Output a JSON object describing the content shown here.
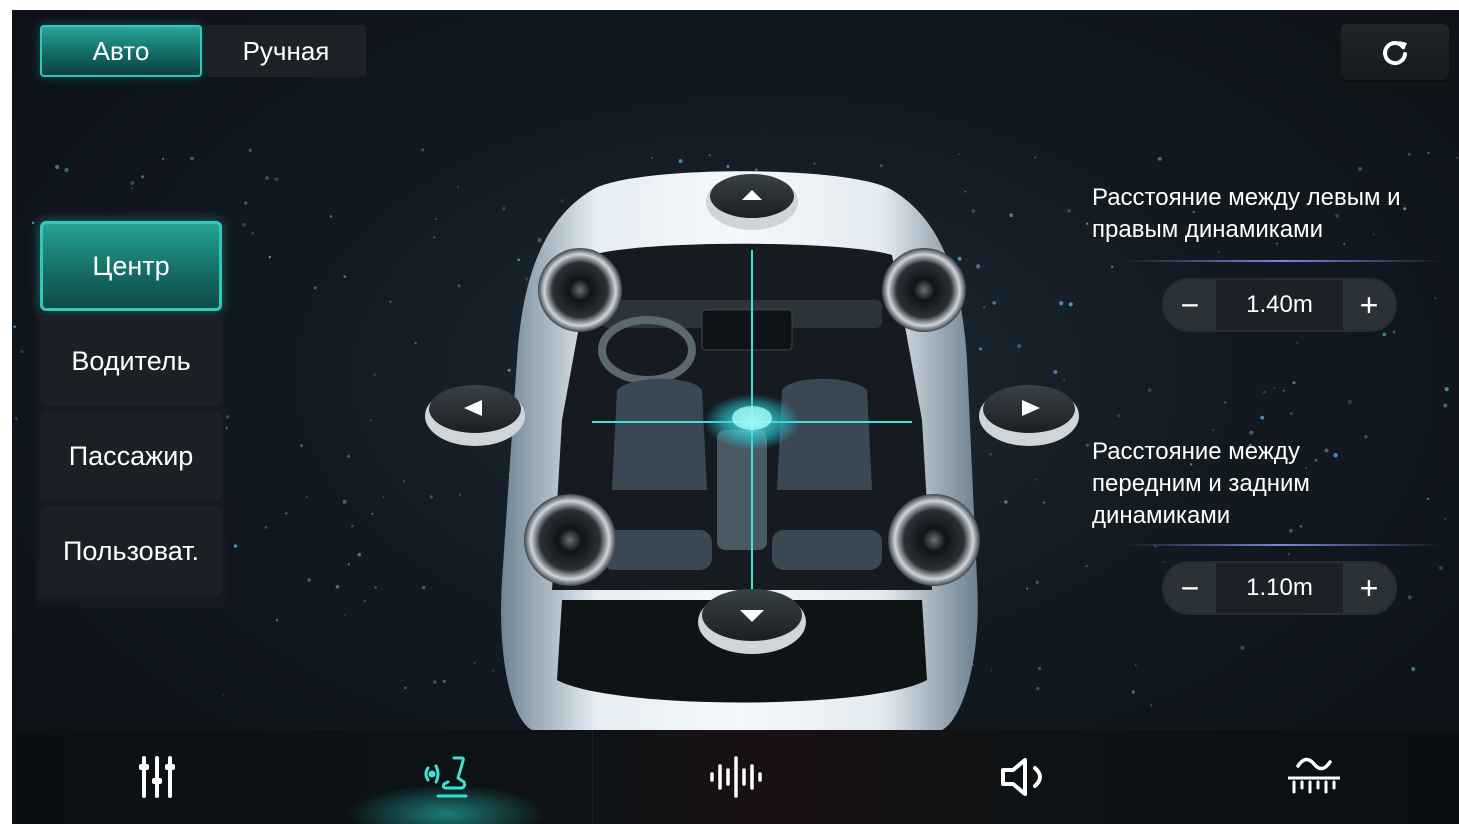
{
  "mode": {
    "auto_label": "Авто",
    "manual_label": "Ручная",
    "selected": "Авто"
  },
  "reset": {
    "icon": "refresh-icon"
  },
  "presets": {
    "items": [
      {
        "label": "Центр",
        "active": true
      },
      {
        "label": "Водитель",
        "active": false
      },
      {
        "label": "Пассажир",
        "active": false
      },
      {
        "label": "Пользоват.",
        "active": false
      }
    ]
  },
  "left_right": {
    "label": "Расстояние между левым и правым динамиками",
    "value": "1.40m",
    "minus_label": "−",
    "plus_label": "+"
  },
  "front_rear": {
    "label": "Расстояние между передним и задним динамиками",
    "value": "1.10m",
    "minus_label": "−",
    "plus_label": "+"
  },
  "bottom_tabs": [
    {
      "icon": "equalizer-sliders-icon",
      "active": false
    },
    {
      "icon": "seat-sound-field-icon",
      "active": true
    },
    {
      "icon": "sound-wave-icon",
      "active": false
    },
    {
      "icon": "speaker-volume-icon",
      "active": false
    },
    {
      "icon": "bass-filter-icon",
      "active": false
    }
  ],
  "colors": {
    "accent": "#2fc2b3",
    "active_icon": "#3ee0d4",
    "crosshair": "#48e0dc"
  }
}
